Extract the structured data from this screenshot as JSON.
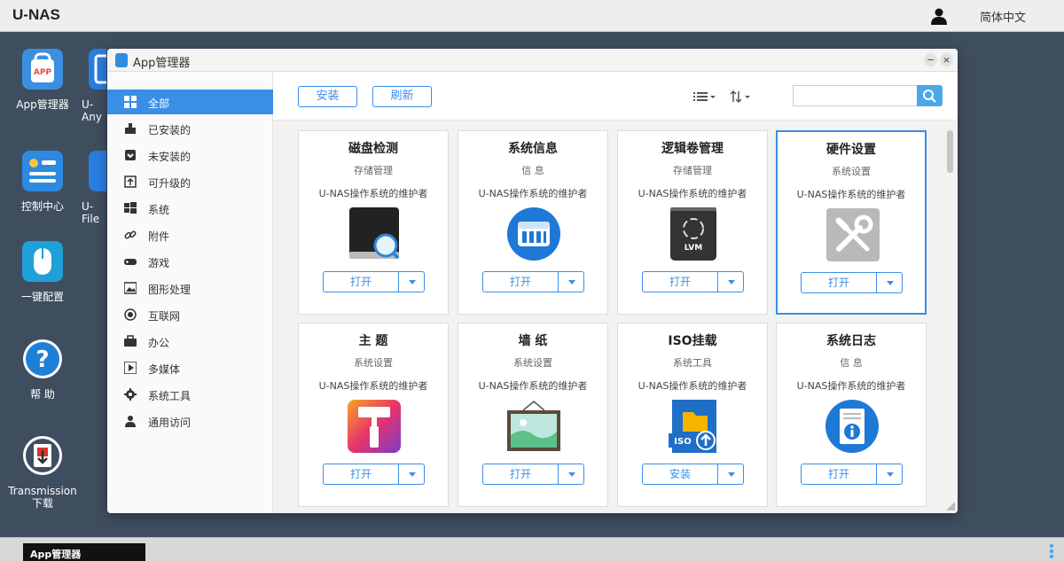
{
  "topbar": {
    "brand": "U-NAS",
    "language": "简体中文"
  },
  "desktop": {
    "icons": [
      {
        "label": "App管理器"
      },
      {
        "label": "U-Any"
      },
      {
        "label": "控制中心"
      },
      {
        "label": "U-File"
      },
      {
        "label": "一键配置"
      },
      {
        "label": "帮 助"
      },
      {
        "label": "Transmission下载"
      }
    ]
  },
  "window": {
    "title": "App管理器",
    "minimize_label": "−",
    "close_label": "×"
  },
  "sidebar": {
    "items": [
      {
        "label": "全部",
        "icon": "grid-icon"
      },
      {
        "label": "已安装的",
        "icon": "installed-icon"
      },
      {
        "label": "未安装的",
        "icon": "uninstalled-icon"
      },
      {
        "label": "可升级的",
        "icon": "upgrade-icon"
      },
      {
        "label": "系统",
        "icon": "windows-icon"
      },
      {
        "label": "附件",
        "icon": "link-icon"
      },
      {
        "label": "游戏",
        "icon": "gamepad-icon"
      },
      {
        "label": "图形处理",
        "icon": "image-icon"
      },
      {
        "label": "互联网",
        "icon": "globe-icon"
      },
      {
        "label": "办公",
        "icon": "briefcase-icon"
      },
      {
        "label": "多媒体",
        "icon": "play-icon"
      },
      {
        "label": "系统工具",
        "icon": "gear-icon"
      },
      {
        "label": "通用访问",
        "icon": "person-icon"
      }
    ],
    "active_index": 0
  },
  "toolbar": {
    "install_label": "安装",
    "refresh_label": "刷新",
    "search_placeholder": ""
  },
  "apps": [
    {
      "name": "磁盘检测",
      "category": "存储管理",
      "maintainer": "U-NAS操作系统的维护者",
      "button": "打开",
      "icon": "disk-check-icon"
    },
    {
      "name": "系统信息",
      "category": "信 息",
      "maintainer": "U-NAS操作系统的维护者",
      "button": "打开",
      "icon": "system-info-icon"
    },
    {
      "name": "逻辑卷管理",
      "category": "存储管理",
      "maintainer": "U-NAS操作系统的维护者",
      "button": "打开",
      "icon": "lvm-icon"
    },
    {
      "name": "硬件设置",
      "category": "系统设置",
      "maintainer": "U-NAS操作系统的维护者",
      "button": "打开",
      "icon": "tools-icon"
    },
    {
      "name": "主 题",
      "category": "系统设置",
      "maintainer": "U-NAS操作系统的维护者",
      "button": "打开",
      "icon": "theme-icon"
    },
    {
      "name": "墙 纸",
      "category": "系统设置",
      "maintainer": "U-NAS操作系统的维护者",
      "button": "打开",
      "icon": "wallpaper-icon"
    },
    {
      "name": "ISO挂载",
      "category": "系统工具",
      "maintainer": "U-NAS操作系统的维护者",
      "button": "安装",
      "icon": "iso-icon"
    },
    {
      "name": "系统日志",
      "category": "信 息",
      "maintainer": "U-NAS操作系统的维护者",
      "button": "打开",
      "icon": "log-info-icon"
    }
  ],
  "taskbar": {
    "items": [
      {
        "label": "App管理器"
      }
    ]
  },
  "colors": {
    "accent": "#3a8ee6",
    "desktop": "#3f4e5f"
  }
}
